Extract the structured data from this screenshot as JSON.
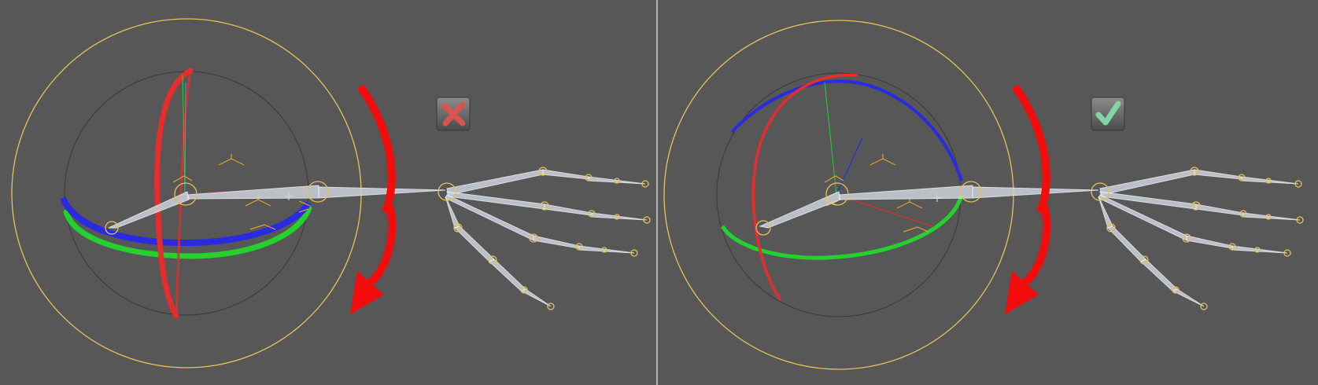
{
  "viewport": {
    "background": "#575757",
    "divider_color": "#cfcfcf",
    "panels": [
      {
        "id": "left",
        "label_icon": "cross-mark-icon",
        "status": "incorrect",
        "badge_color": "#d9534f"
      },
      {
        "id": "right",
        "label_icon": "check-mark-icon",
        "status": "correct",
        "badge_color": "#7fd6a3"
      }
    ]
  },
  "colors": {
    "outer_ring": "#e6c25a",
    "inner_ring": "#3a3a3a",
    "x_axis": "#e52d2d",
    "y_axis": "#24d12e",
    "z_axis": "#2a2ae0",
    "rotation_arrow": "#f20c0c",
    "bone_fill": "#cdd3dc",
    "bone_stroke": "#f2f4f8",
    "joint": "#e6c25a",
    "locator": "#e5a02c"
  },
  "icons": {
    "rotation": "curved-arrow-icon",
    "bone": "bone-icon",
    "joint": "joint-icon"
  }
}
